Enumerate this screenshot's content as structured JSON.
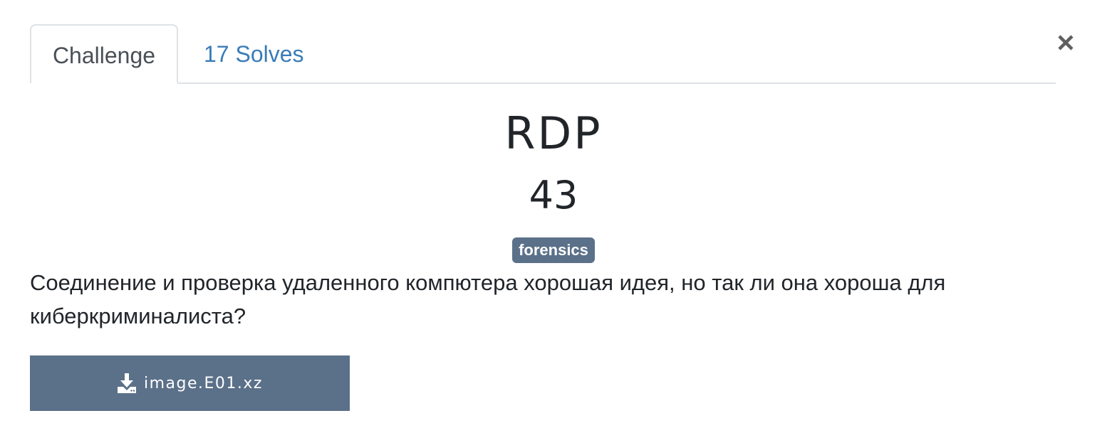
{
  "tabs": [
    {
      "label": "Challenge",
      "active": true
    },
    {
      "label": "17 Solves",
      "active": false
    }
  ],
  "close": {
    "icon": "close-icon",
    "glyph": "×"
  },
  "challenge": {
    "name": "RDP",
    "points": "43",
    "tag": "forensics",
    "description": "Соединение и проверка удаленного компютера хорошая идея, но так ли она хороша для киберкриминалиста?"
  },
  "files": [
    {
      "label": "image.E01.xz",
      "icon": "download-icon"
    }
  ],
  "colors": {
    "accent": "#5b7089",
    "link": "#3a7cb8",
    "text": "#212529",
    "border": "#dee2e6"
  }
}
